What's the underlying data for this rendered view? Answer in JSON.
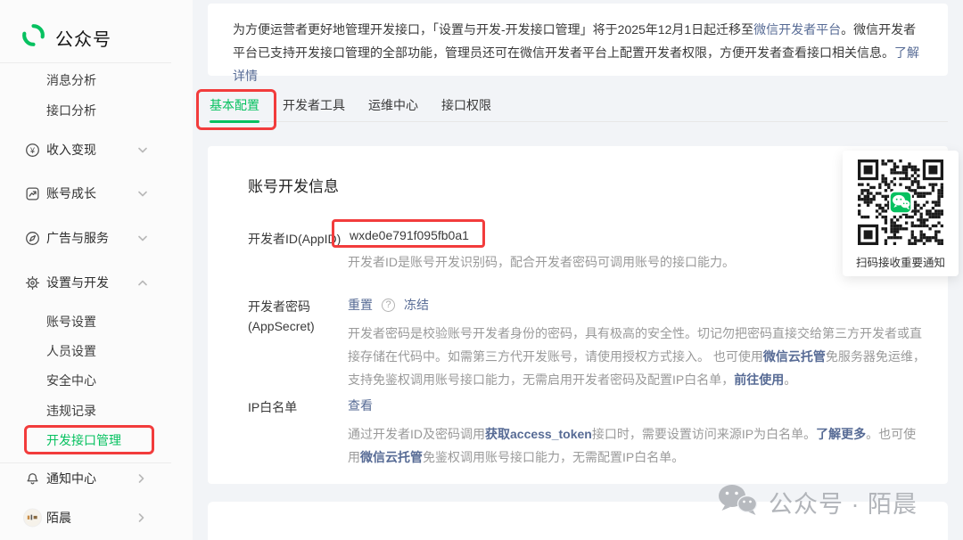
{
  "sidebar": {
    "brand": "公众号",
    "items": [
      {
        "label": "消息分析"
      },
      {
        "label": "接口分析"
      },
      {
        "label": "收入变现"
      },
      {
        "label": "账号成长"
      },
      {
        "label": "广告与服务"
      },
      {
        "label": "设置与开发"
      },
      {
        "label": "账号设置"
      },
      {
        "label": "人员设置"
      },
      {
        "label": "安全中心"
      },
      {
        "label": "违规记录"
      },
      {
        "label": "开发接口管理",
        "active": true
      },
      {
        "label": "通知中心"
      },
      {
        "label": "陌晨"
      }
    ]
  },
  "banner": {
    "part1": "为方便运营者更好地管理开发接口，「设置与开发-开发接口管理」将于2025年12月1日起迁移至",
    "link_platform": "微信开发者平台",
    "part2": "。微信开发者平台已支持开发接口管理的全部功能，管理员还可在微信开发者平台上配置开发者权限，方便开发者查看接口相关信息。",
    "link_detail": "了解详情"
  },
  "tabs": {
    "items": [
      {
        "label": "基本配置",
        "active": true
      },
      {
        "label": "开发者工具"
      },
      {
        "label": "运维中心"
      },
      {
        "label": "接口权限"
      }
    ]
  },
  "main": {
    "section_title": "账号开发信息",
    "appid": {
      "label": "开发者ID(AppID)",
      "value": "wxde0e791f095fb0a1",
      "desc": "开发者ID是账号开发识别码，配合开发者密码可调用账号的接口能力。"
    },
    "appsecret": {
      "label": "开发者密码(AppSecret)",
      "reset_label": "重置",
      "help_glyph": "?",
      "freeze_label": "冻结",
      "desc_p1": "开发者密码是校验账号开发者身份的密码，具有极高的安全性。切记勿把密码直接交给第三方开发者或直接存储在代码中。如需第三方代开发账号，请使用授权方式接入。 也可使用",
      "link_cloud": "微信云托管",
      "desc_p2": "免服务器免运维，支持免鉴权调用账号接口能力，无需启用开发者密码及配置IP白名单，",
      "link_go": "前往使用",
      "desc_p3": "。"
    },
    "ip": {
      "label": "IP白名单",
      "view_label": "查看",
      "desc_p1": "通过开发者ID及密码调用",
      "link_token": "获取access_token",
      "desc_p2": "接口时，需要设置访问来源IP为白名单。",
      "link_more": "了解更多",
      "desc_p3": "。也可使用",
      "link_cloud": "微信云托管",
      "desc_p4": "免鉴权调用账号接口能力，无需配置IP白名单。"
    }
  },
  "qr_card": {
    "caption": "扫码接收重要通知"
  },
  "watermark": {
    "label": "公众号 · 陌晨"
  },
  "icon_glyphs": {
    "yen": "¥"
  },
  "colors": {
    "brand_green": "#07c160",
    "link_blue": "#576b95",
    "annotation_red": "#f23c3c",
    "page_background": "#f2f4f7",
    "sidebar_background": "#fbfbfb"
  }
}
